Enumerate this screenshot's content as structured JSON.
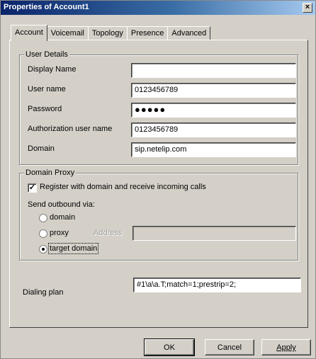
{
  "window": {
    "title": "Properties of Account1",
    "close_glyph": "×"
  },
  "tabs": [
    "Account",
    "Voicemail",
    "Topology",
    "Presence",
    "Advanced"
  ],
  "user_details": {
    "group_label": "User Details",
    "display_name": {
      "label": "Display Name",
      "value": ""
    },
    "user_name": {
      "label": "User name",
      "value": "0123456789"
    },
    "password": {
      "label": "Password",
      "value": "●●●●●"
    },
    "auth_user": {
      "label": "Authorization user name",
      "value": "0123456789"
    },
    "domain": {
      "label": "Domain",
      "value": "sip.netelip.com"
    }
  },
  "domain_proxy": {
    "group_label": "Domain Proxy",
    "register_label": "Register with domain and receive incoming calls",
    "register_checked": true,
    "check_glyph": "✓",
    "send_outbound_label": "Send outbound via:",
    "options": [
      "domain",
      "proxy",
      "target domain"
    ],
    "selected": "target domain",
    "address_label": "Address",
    "address_value": ""
  },
  "dialing_plan": {
    "label": "Dialing plan",
    "value": "#1\\a\\a.T;match=1;prestrip=2;"
  },
  "buttons": {
    "ok": "OK",
    "cancel": "Cancel",
    "apply": "Apply"
  }
}
